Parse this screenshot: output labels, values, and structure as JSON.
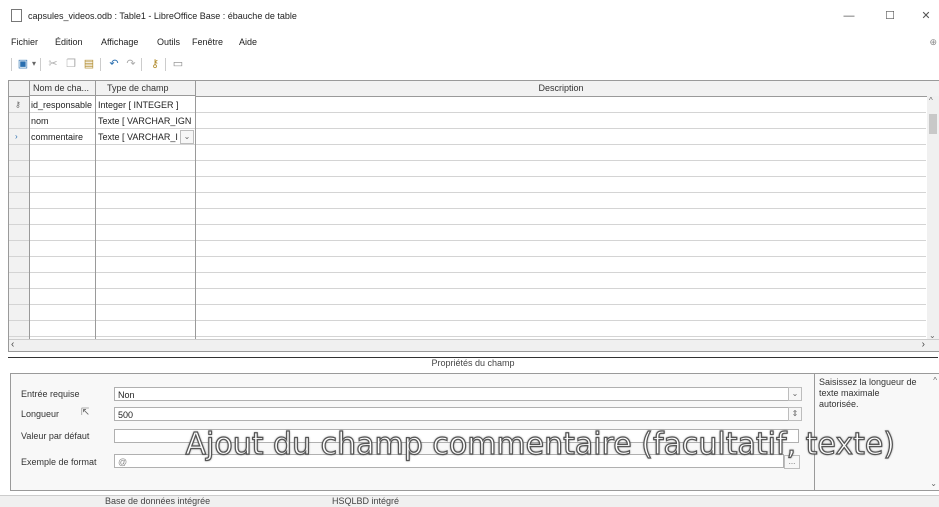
{
  "window": {
    "title": "capsules_videos.odb : Table1 - LibreOffice Base : ébauche de table",
    "controls": {
      "minimize": "—",
      "maximize": "☐",
      "close": "✕"
    }
  },
  "menu": [
    "Fichier",
    "Édition",
    "Affichage",
    "Outils",
    "Fenêtre",
    "Aide"
  ],
  "toolbar": {
    "icons": [
      "save-icon",
      "dropdown-arrow-icon",
      "cut-icon",
      "copy-icon",
      "paste-icon",
      "undo-icon",
      "redo-icon",
      "primary-key-icon",
      "index-design-icon"
    ]
  },
  "table": {
    "columns": [
      "Nom de cha...",
      "Type de champ",
      "Description"
    ],
    "rows": [
      {
        "marker": "⚷",
        "name": "id_responsable",
        "type": "Integer [ INTEGER ]",
        "description": ""
      },
      {
        "marker": "",
        "name": "nom",
        "type": "Texte [ VARCHAR_IGN",
        "description": ""
      },
      {
        "marker": "›",
        "name": "commentaire",
        "type": "Texte [ VARCHAR_I",
        "description": ""
      }
    ]
  },
  "properties": {
    "title": "Propriétés du champ",
    "fields": [
      {
        "label": "Entrée requise",
        "value": "Non",
        "control": "dropdown"
      },
      {
        "label": "Longueur",
        "value": "500",
        "control": "spinner"
      },
      {
        "label": "Valeur par défaut",
        "value": "",
        "control": "text"
      },
      {
        "label": "Exemple de format",
        "value": "@",
        "control": "button",
        "button_label": "..."
      }
    ],
    "help": "Saisissez la longueur de texte maximale autorisée."
  },
  "status": {
    "db": "Base de données intégrée",
    "engine": "HSQLBD intégré"
  },
  "caption": "Ajout du champ commentaire (facultatif, texte)"
}
